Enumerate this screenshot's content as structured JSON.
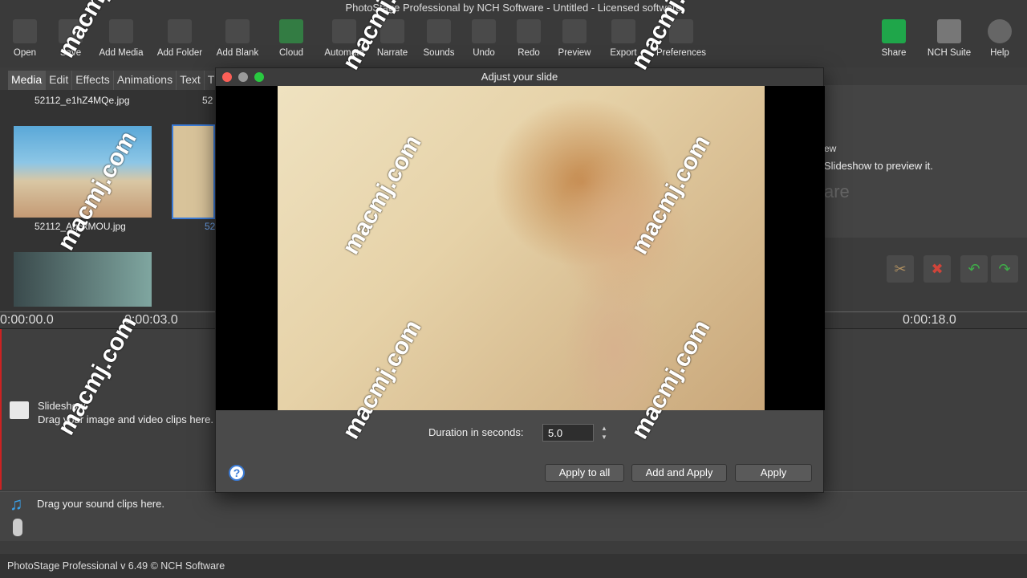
{
  "window": {
    "title": "PhotoStage Professional by NCH Software - Untitled - Licensed software"
  },
  "toolbar": [
    {
      "label": "Open",
      "icon": "folder-open-icon"
    },
    {
      "label": "Save",
      "icon": "save-icon"
    },
    {
      "label": "Add Media",
      "icon": "add-media-icon"
    },
    {
      "label": "Add Folder",
      "icon": "add-folder-icon"
    },
    {
      "label": "Add Blank",
      "icon": "add-blank-icon"
    },
    {
      "label": "Cloud",
      "icon": "cloud-download-icon"
    },
    {
      "label": "Automate",
      "icon": "magic-wand-icon"
    },
    {
      "label": "Narrate",
      "icon": "microphone-icon"
    },
    {
      "label": "Sounds",
      "icon": "music-folder-icon"
    },
    {
      "label": "Undo",
      "icon": "undo-icon"
    },
    {
      "label": "Redo",
      "icon": "redo-icon"
    },
    {
      "label": "Preview",
      "icon": "film-icon"
    },
    {
      "label": "Export",
      "icon": "export-icon"
    },
    {
      "label": "Preferences",
      "icon": "tools-icon"
    }
  ],
  "toolbar_right": [
    {
      "label": "Share",
      "icon": "share-icon"
    },
    {
      "label": "NCH Suite",
      "icon": "nch-suite-icon"
    },
    {
      "label": "Help",
      "icon": "help-icon"
    }
  ],
  "tabs": [
    "Media",
    "Edit",
    "Effects",
    "Animations",
    "Text",
    "T"
  ],
  "media": {
    "items": [
      "52112_e1hZ4MQe.jpg",
      "52",
      "52112_Aq5xMOU.jpg",
      "52"
    ]
  },
  "preview": {
    "line1": "ew",
    "line2": "Slideshow to preview it.",
    "brand": "are"
  },
  "timeline": {
    "ticks": [
      "0:00:00.0",
      "0:00:03.0",
      "0:00:18.0"
    ],
    "track_title": "Slideshow",
    "track_hint": "Drag your image and video clips here.",
    "sound_hint": "Drag your sound clips here."
  },
  "dialog": {
    "title": "Adjust your slide",
    "duration_label": "Duration in seconds:",
    "duration_value": "5.0",
    "buttons": [
      "Apply to all",
      "Add and Apply",
      "Apply"
    ]
  },
  "status": "PhotoStage Professional v 6.49 © NCH Software",
  "watermark": "macmj.com",
  "colors": {
    "accent_blue": "#3b7bd6",
    "share_green": "#1fa64a",
    "delete_red": "#c0392b"
  }
}
